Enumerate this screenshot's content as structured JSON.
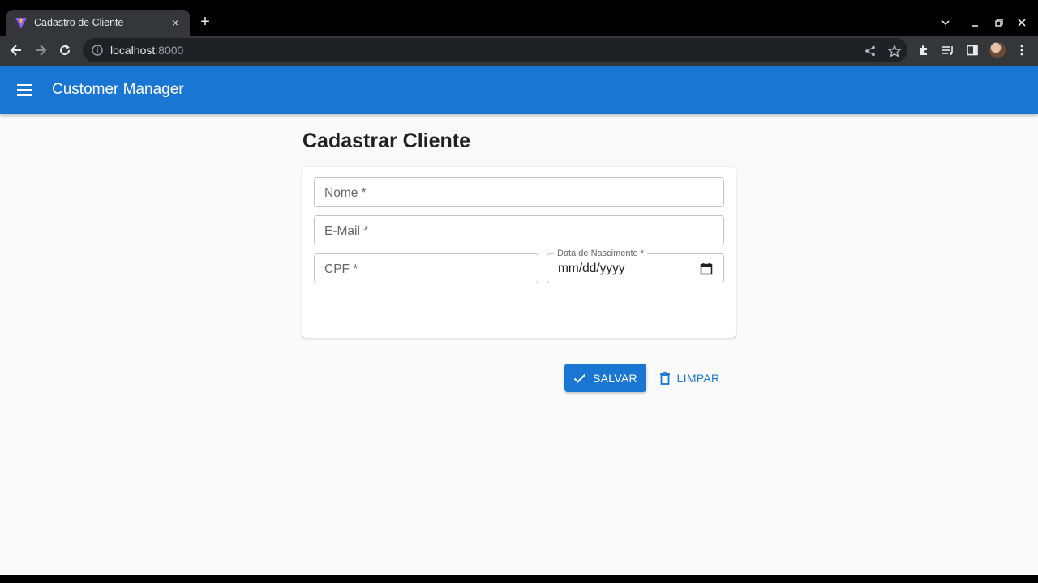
{
  "browser": {
    "tab_title": "Cadastro de Cliente",
    "tab_close": "×",
    "new_tab": "+",
    "url_host": "localhost",
    "url_port": ":8000"
  },
  "app": {
    "title": "Customer Manager",
    "primary_color": "#1976d2"
  },
  "form": {
    "heading": "Cadastrar Cliente",
    "fields": {
      "nome_placeholder": "Nome *",
      "email_placeholder": "E-Mail *",
      "cpf_placeholder": "CPF *",
      "birth_label": "Data de Nascimento *",
      "birth_value": "mm/dd/yyyy"
    },
    "buttons": {
      "save": "SALVAR",
      "clear": "LIMPAR"
    }
  }
}
